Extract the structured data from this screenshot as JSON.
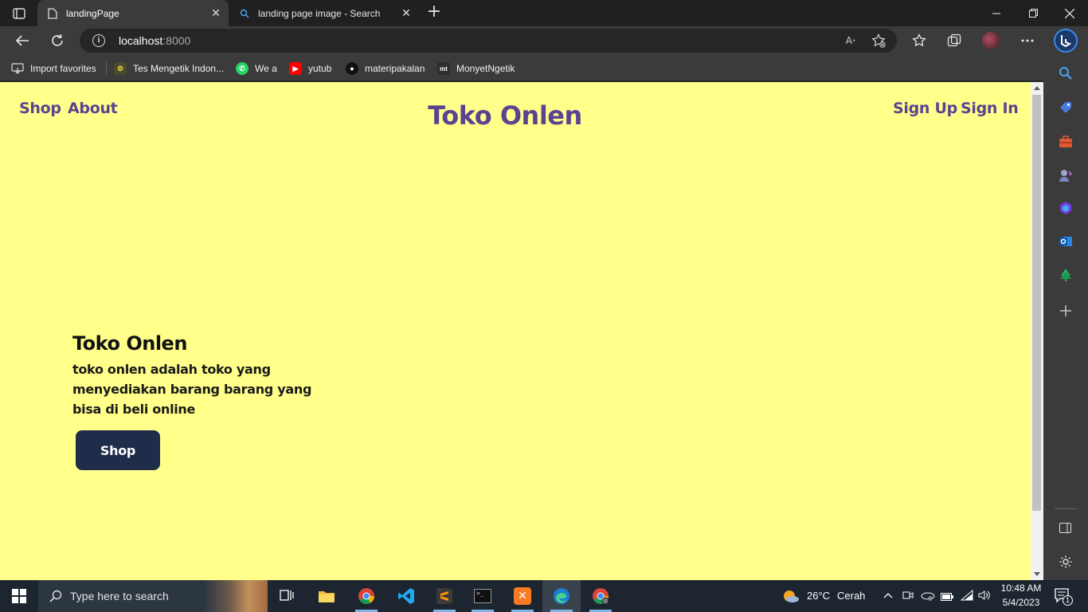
{
  "browser": {
    "tabs": [
      {
        "title": "landingPage",
        "active": true
      },
      {
        "title": "landing page image - Search",
        "active": false
      }
    ],
    "address": {
      "host": "localhost",
      "port": ":8000"
    },
    "favorites": [
      {
        "label": "Import favorites",
        "icon": "import-icon"
      },
      {
        "label": "Tes Mengetik Indon...",
        "icon": "keyboard-test-icon"
      },
      {
        "label": "We a",
        "icon": "whatsapp-icon"
      },
      {
        "label": "yutub",
        "icon": "youtube-icon"
      },
      {
        "label": "materipakalan",
        "icon": "github-icon"
      },
      {
        "label": "MonyetNgetik",
        "icon": "monkeytype-icon"
      }
    ]
  },
  "page": {
    "nav_left": [
      "Shop",
      "About"
    ],
    "brand": "Toko Onlen",
    "nav_right": [
      "Sign Up",
      "Sign In"
    ],
    "hero": {
      "title": "Toko Onlen",
      "description": "toko onlen adalah toko yang menyediakan barang barang yang bisa di beli online",
      "button": "Shop"
    },
    "colors": {
      "background": "#ffff8a",
      "accent": "#5a4391",
      "button": "#1f2d4b"
    }
  },
  "taskbar": {
    "search_placeholder": "Type here to search",
    "weather": {
      "temp": "26°C",
      "condition": "Cerah"
    },
    "time": "10:48 AM",
    "date": "5/4/2023",
    "notifications": "1"
  }
}
